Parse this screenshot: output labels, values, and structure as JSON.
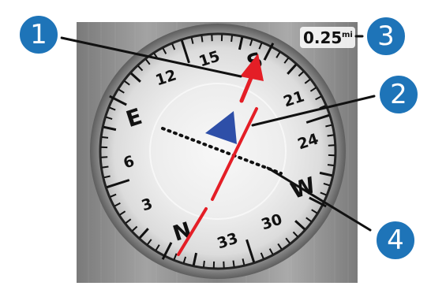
{
  "compass": {
    "labels": {
      "north": "N",
      "east": "E",
      "south": "S",
      "west": "W",
      "d3": "3",
      "d6": "6",
      "d12": "12",
      "d15": "15",
      "d21": "21",
      "d24": "24",
      "d30": "30",
      "d33": "33"
    },
    "distance": {
      "value": "0.25",
      "unit": "mi"
    }
  },
  "callouts": [
    "1",
    "2",
    "3",
    "4"
  ],
  "colors": {
    "callout_blue": "#1e74b8",
    "bearing_red": "#e41e26",
    "heading_blue": "#2e4fa8",
    "course_dots": "#111111",
    "panel_gray": "#8b8b8b"
  },
  "icons": {
    "bearing_arrow": "red-bearing-arrow-icon",
    "position_marker": "blue-position-triangle-icon",
    "course_line": "dotted-course-line-icon"
  }
}
